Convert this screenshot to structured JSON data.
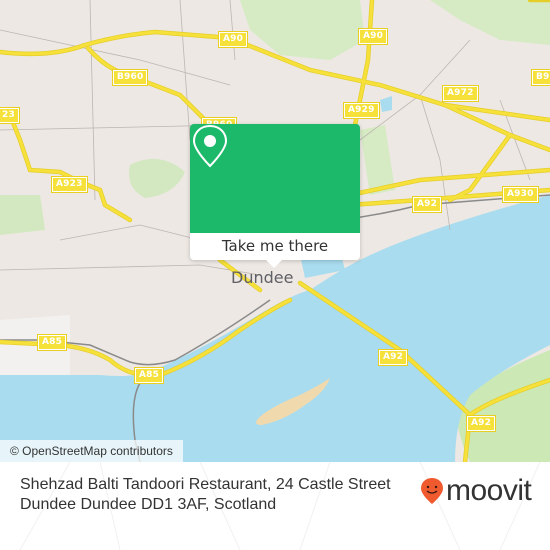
{
  "map": {
    "city_label": "Dundee",
    "road_labels": [
      {
        "id": "a90-west",
        "text": "A90"
      },
      {
        "id": "a90-east",
        "text": "A90"
      },
      {
        "id": "b960-1",
        "text": "B960"
      },
      {
        "id": "b960-2",
        "text": "B960"
      },
      {
        "id": "b9-right",
        "text": "B9"
      },
      {
        "id": "a923-left",
        "text": "23"
      },
      {
        "id": "a923",
        "text": "A923"
      },
      {
        "id": "a929",
        "text": "A929"
      },
      {
        "id": "a972",
        "text": "A972"
      },
      {
        "id": "a930",
        "text": "A930"
      },
      {
        "id": "a92-north",
        "text": "A92"
      },
      {
        "id": "a92-bridge",
        "text": "A92"
      },
      {
        "id": "a92-south",
        "text": "A92"
      },
      {
        "id": "a85-west",
        "text": "A85"
      },
      {
        "id": "a85-east",
        "text": "A85"
      }
    ],
    "colors": {
      "water": "#a9dcee",
      "land": "#ede8e4",
      "park": "#cce8b5",
      "road": "#f6e03a",
      "sand": "#f1d9ae",
      "popup_green": "#1db96b",
      "moovit_orange": "#ef5a2f"
    }
  },
  "popup": {
    "icon": "location-pin-icon",
    "button_label": "Take me there"
  },
  "attribution": "© OpenStreetMap contributors",
  "footer": {
    "address_line1": "Shehzad Balti Tandoori Restaurant, 24 Castle Street",
    "address_line2": "Dundee Dundee DD1 3AF, Scotland",
    "brand": "moovit",
    "brand_icon": "moovit-smile-pin-icon"
  }
}
